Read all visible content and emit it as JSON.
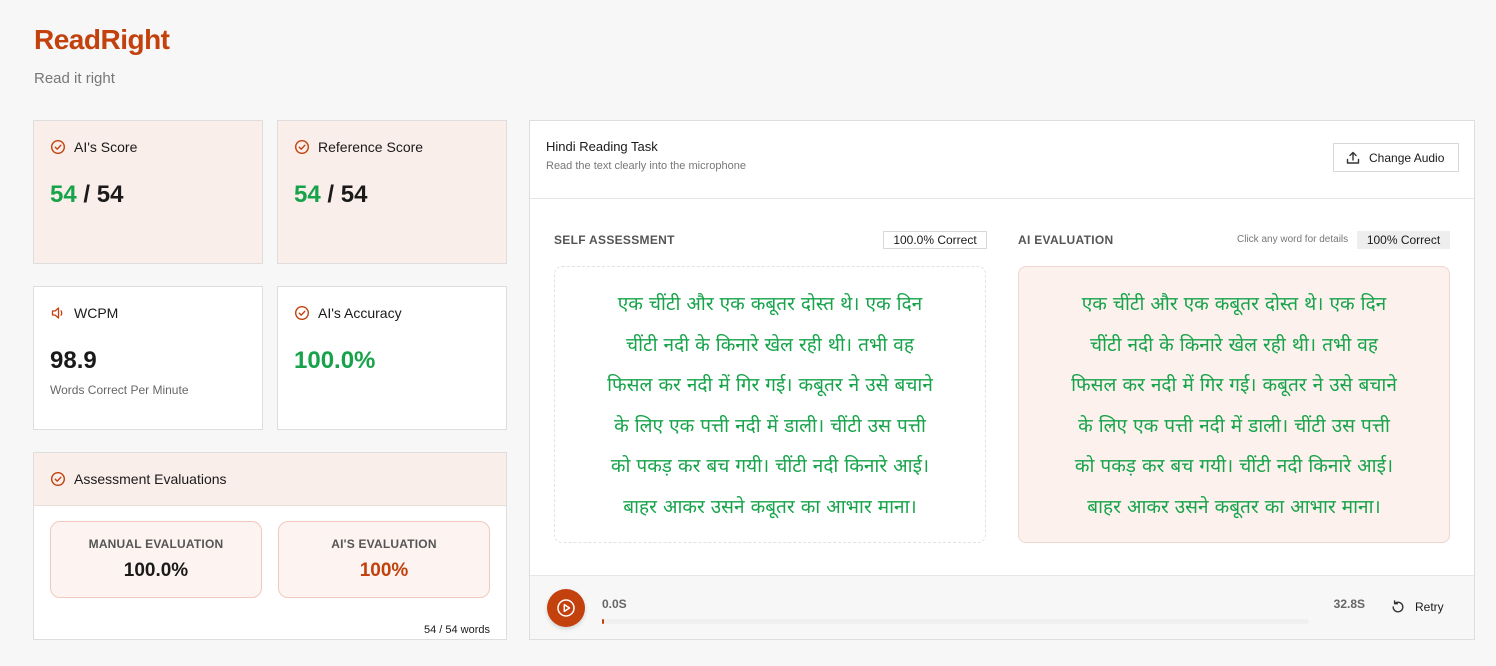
{
  "app": {
    "title": "ReadRight",
    "subtitle": "Read it right"
  },
  "colors": {
    "accent": "#c2410c",
    "correct": "#16a34a",
    "tint": "#f9eeea"
  },
  "cards": {
    "ai_score": {
      "label": "AI's Score",
      "icon": "check-circle-icon",
      "correct": "54",
      "sep": " / ",
      "total": "54"
    },
    "reference_score": {
      "label": "Reference Score",
      "icon": "check-circle-icon",
      "correct": "54",
      "sep": " / ",
      "total": "54"
    },
    "wcpm": {
      "label": "WCPM",
      "icon": "speaker-icon",
      "value": "98.9",
      "sub": "Words Correct Per Minute"
    },
    "ai_accuracy": {
      "label": "AI's Accuracy",
      "icon": "check-circle-icon",
      "value": "100.0%"
    }
  },
  "assessment": {
    "title": "Assessment Evaluations",
    "manual": {
      "label": "MANUAL EVALUATION",
      "value": "100.0%"
    },
    "ai": {
      "label": "AI'S EVALUATION",
      "value": "100%"
    },
    "words": "54 / 54 words"
  },
  "task": {
    "title": "Hindi Reading Task",
    "subtitle": "Read the text clearly into the microphone",
    "change_audio": "Change Audio"
  },
  "self_assessment": {
    "label": "SELF ASSESSMENT",
    "badge": "100.0% Correct",
    "lines": [
      "एक चींटी और एक कबूतर दोस्त थे। एक दिन",
      "चींटी नदी के किनारे खेल रही थी। तभी वह",
      "फिसल कर नदी में गिर गई। कबूतर ने उसे बचाने",
      "के लिए एक पत्ती नदी में डाली। चींटी उस पत्ती",
      "को पकड़ कर बच गयी। चींटी नदी किनारे आई।",
      "बाहर आकर उसने कबूतर का आभार माना।"
    ]
  },
  "ai_evaluation": {
    "label": "AI EVALUATION",
    "hint": "Click any word for details",
    "badge": "100% Correct",
    "lines": [
      "एक चींटी और एक कबूतर दोस्त थे। एक दिन",
      "चींटी नदी के किनारे खेल रही थी। तभी वह",
      "फिसल कर नदी में गिर गई। कबूतर ने उसे बचाने",
      "के लिए एक पत्ती नदी में डाली। चींटी उस पत्ती",
      "को पकड़ कर बच गयी। चींटी नदी किनारे आई।",
      "बाहर आकर उसने कबूतर का आभार माना।"
    ]
  },
  "player": {
    "current": "0.0S",
    "duration": "32.8S",
    "progress": 0.002,
    "retry": "Retry"
  }
}
